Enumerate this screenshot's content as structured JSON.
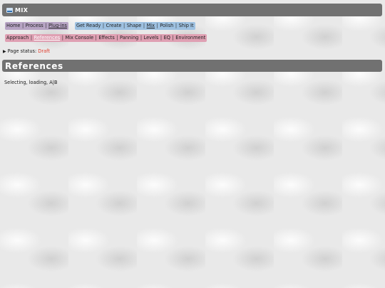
{
  "window": {
    "title": "MIX"
  },
  "nav_primary": [
    "Home",
    "Process",
    "Plug-ins"
  ],
  "nav_secondary": [
    "Get Ready",
    "Create",
    "Shape",
    "Mix",
    "Polish",
    "Ship It"
  ],
  "nav_tertiary": [
    "Approach",
    "References",
    "Mix Console",
    "Effects",
    "Panning",
    "Levels",
    "EQ",
    "Environment"
  ],
  "status": {
    "label": "Page status:",
    "value": "Draft"
  },
  "page": {
    "heading": "References",
    "body": "Selecting, loading, A|B"
  },
  "colors": {
    "title_bar": "#717171",
    "nav_purple": "#b7a4c4",
    "nav_blue": "#9ec1e1",
    "nav_pink": "#dfa0b3",
    "draft": "#e03a2a"
  },
  "icons": {
    "title": "audio-mixer-icon",
    "disclosure": "triangle-right-icon"
  }
}
